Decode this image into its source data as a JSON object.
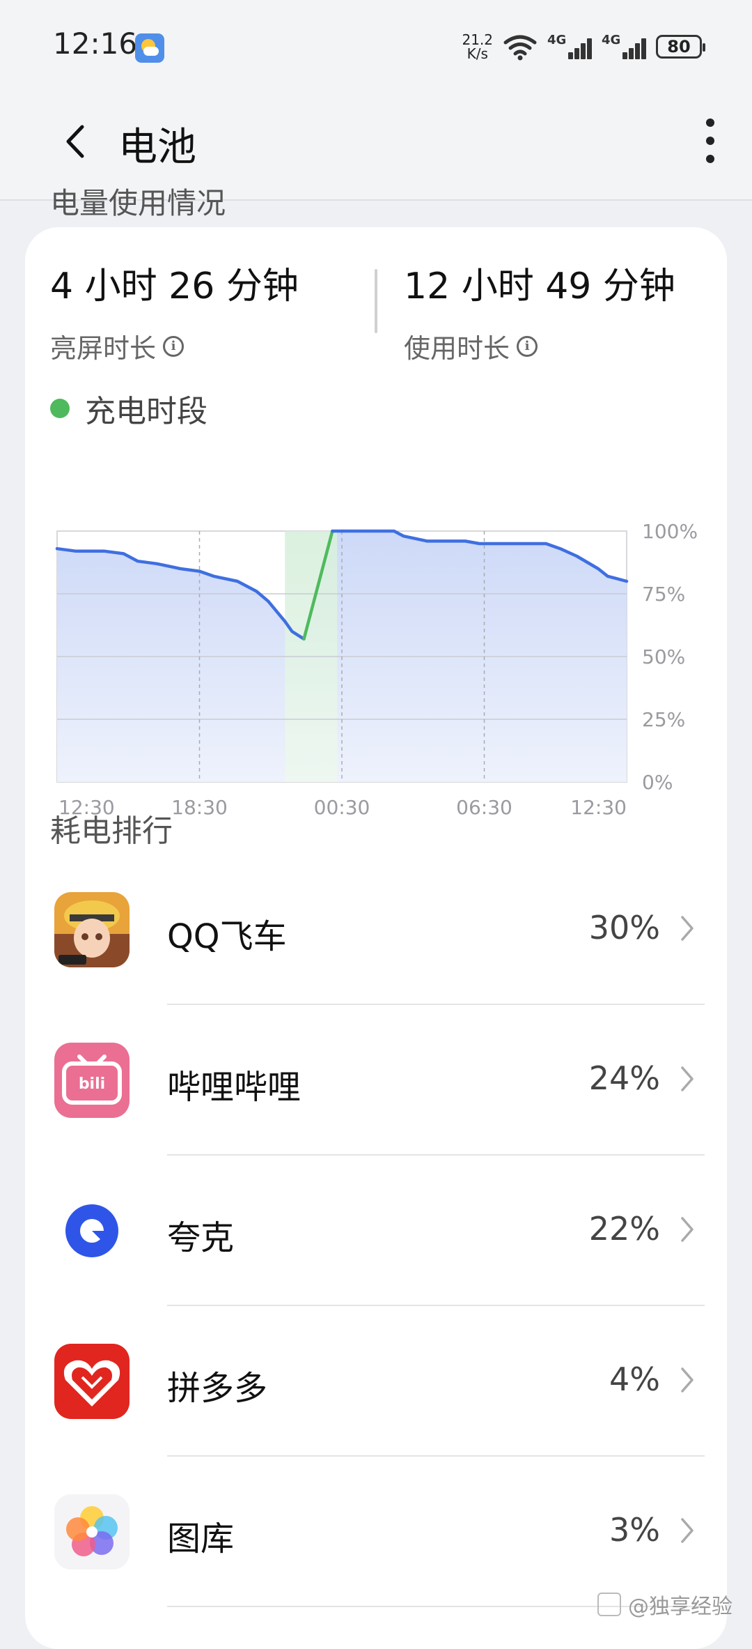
{
  "status_bar": {
    "time": "12:16",
    "net_speed_value": "21.2",
    "net_speed_unit": "K/s",
    "sim1_label": "4G",
    "sim2_label": "4G",
    "battery_level": "80"
  },
  "header": {
    "title": "电池"
  },
  "peek_title": "电量使用情况",
  "stats": {
    "screen_time": {
      "value": "4 小时 26 分钟",
      "label": "亮屏时长"
    },
    "usage_time": {
      "value": "12 小时 49 分钟",
      "label": "使用时长"
    }
  },
  "legend": {
    "label": "充电时段",
    "color": "#4fba5d"
  },
  "chart_data": {
    "type": "area",
    "x_ticks": [
      "12:30",
      "18:30",
      "00:30",
      "06:30",
      "12:30"
    ],
    "y_ticks": [
      "100%",
      "75%",
      "50%",
      "25%",
      "0%"
    ],
    "ylim": [
      0,
      100
    ],
    "line_color": "#3f6fe0",
    "charging_color": "#4fba5d",
    "x_hours_since_1230": [
      0,
      0.8,
      2,
      2.8,
      3.4,
      4.2,
      5.2,
      6,
      6.6,
      7.6,
      8.4,
      8.9,
      9.6,
      9.9,
      10.4,
      11.6,
      12.2,
      13.4,
      14.2,
      14.6,
      15.6,
      16.2,
      17.2,
      17.8,
      19.4,
      20.6,
      21.2,
      21.9,
      22.8,
      23.2,
      24
    ],
    "battery_percent": [
      93,
      92,
      92,
      91,
      88,
      87,
      85,
      84,
      82,
      80,
      76,
      72,
      64,
      60,
      57,
      100,
      100,
      100,
      100,
      98,
      96,
      96,
      96,
      95,
      95,
      95,
      93,
      90,
      85,
      82,
      80
    ],
    "charging_start_index": 14,
    "charging_end_index": 15,
    "charging_window_hours": [
      9.6,
      11.8
    ]
  },
  "ranking": {
    "title": "耗电排行",
    "apps": [
      {
        "name": "QQ飞车",
        "percent": "30%",
        "icon": "qq-speed-icon"
      },
      {
        "name": "哔哩哔哩",
        "percent": "24%",
        "icon": "bilibili-icon"
      },
      {
        "name": "夸克",
        "percent": "22%",
        "icon": "quark-icon"
      },
      {
        "name": "拼多多",
        "percent": "4%",
        "icon": "pinduoduo-icon"
      },
      {
        "name": "图库",
        "percent": "3%",
        "icon": "gallery-icon"
      }
    ]
  },
  "watermark": "@独享经验"
}
